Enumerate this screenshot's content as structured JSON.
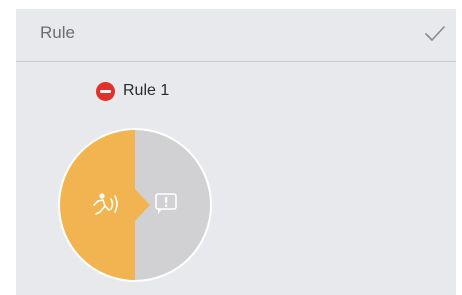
{
  "header": {
    "title": "Rule",
    "confirm_icon": "checkmark-icon"
  },
  "rule": {
    "remove_icon": "minus-circle-icon",
    "label": "Rule 1",
    "trigger_icon": "motion-detection-icon",
    "action_icon": "alarm-message-icon"
  },
  "colors": {
    "panel_bg": "#e8e9ec",
    "trigger": "#f2b451",
    "action": "#d1d1d3",
    "remove": "#e0322a"
  }
}
